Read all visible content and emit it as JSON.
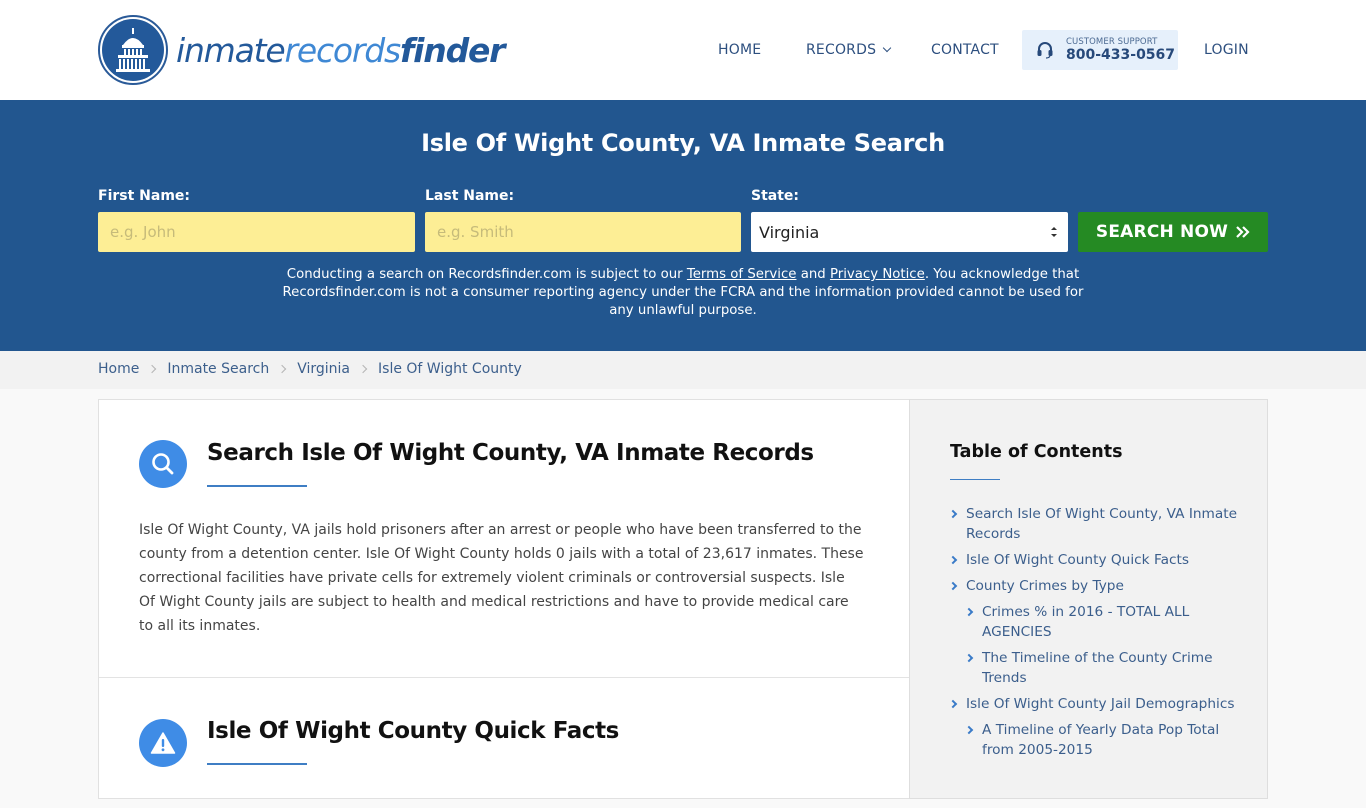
{
  "header": {
    "logo": {
      "part1": "inmate",
      "part2": "records",
      "part3": "finder"
    },
    "nav": {
      "home": "HOME",
      "records": "RECORDS",
      "contact": "CONTACT",
      "login": "LOGIN"
    },
    "support": {
      "label": "CUSTOMER SUPPORT",
      "phone": "800-433-0567"
    }
  },
  "search": {
    "title": "Isle Of Wight County, VA Inmate Search",
    "first_name": {
      "label": "First Name:",
      "placeholder": "e.g. John",
      "value": ""
    },
    "last_name": {
      "label": "Last Name:",
      "placeholder": "e.g. Smith",
      "value": ""
    },
    "state": {
      "label": "State:",
      "selected": "Virginia"
    },
    "button_label": "SEARCH NOW",
    "disclaimer": {
      "pre": "Conducting a search on Recordsfinder.com is subject to our ",
      "terms_link": "Terms of Service",
      "mid": " and ",
      "privacy_link": "Privacy Notice",
      "post": ". You acknowledge that Recordsfinder.com is not a consumer reporting agency under the FCRA and the information provided cannot be used for any unlawful purpose."
    }
  },
  "breadcrumb": [
    "Home",
    "Inmate Search",
    "Virginia",
    "Isle Of Wight County"
  ],
  "main": {
    "sections": [
      {
        "icon": "search-icon",
        "title": "Search Isle Of Wight County, VA Inmate Records",
        "body": "Isle Of Wight County, VA jails hold prisoners after an arrest or people who have been transferred to the county from a detention center. Isle Of Wight County holds 0 jails with a total of 23,617 inmates. These correctional facilities have private cells for extremely violent criminals or controversial suspects. Isle Of Wight County jails are subject to health and medical restrictions and have to provide medical care to all its inmates."
      },
      {
        "icon": "warning-icon",
        "title": "Isle Of Wight County Quick Facts"
      }
    ]
  },
  "toc": {
    "title": "Table of Contents",
    "items": [
      {
        "label": "Search Isle Of Wight County, VA Inmate Records",
        "level": 1
      },
      {
        "label": "Isle Of Wight County Quick Facts",
        "level": 1
      },
      {
        "label": "County Crimes by Type",
        "level": 1
      },
      {
        "label": "Crimes % in 2016 - TOTAL ALL AGENCIES",
        "level": 2
      },
      {
        "label": "The Timeline of the County Crime Trends",
        "level": 2
      },
      {
        "label": "Isle Of Wight County Jail Demographics",
        "level": 1
      },
      {
        "label": "A Timeline of Yearly Data Pop Total from 2005-2015",
        "level": 2
      }
    ]
  },
  "colors": {
    "brand_blue": "#22568f",
    "accent_blue": "#3f8ce6",
    "search_green": "#258a23",
    "input_yellow": "#fdee95"
  }
}
